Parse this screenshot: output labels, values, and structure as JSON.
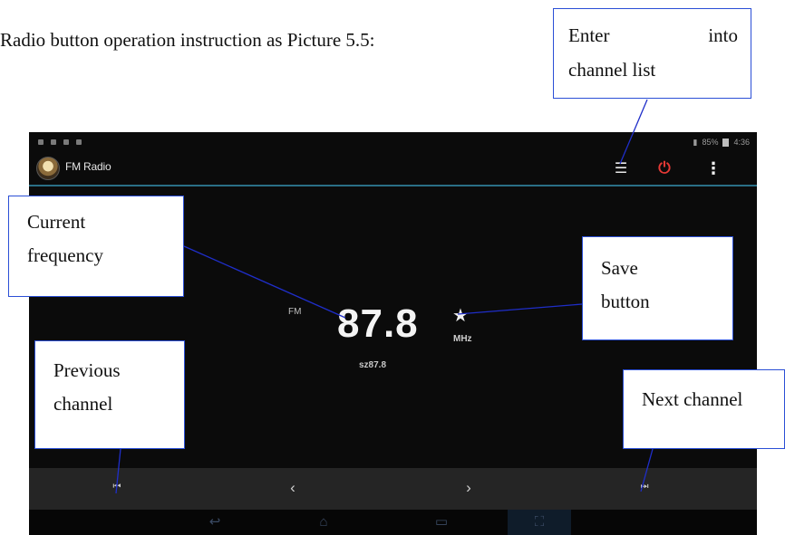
{
  "intro_text": "Radio button operation instruction as Picture 5.5:",
  "tablet": {
    "status": {
      "right_text": "85%",
      "time": "4:36"
    },
    "app_title": "FM Radio",
    "actions": {
      "list_icon": "list-icon",
      "power_icon": "power-icon",
      "menu_icon": "overflow-menu-icon"
    },
    "band": "FM",
    "frequency": "87.8",
    "unit": "MHz",
    "station": "sz87.8",
    "controls": {
      "prev_icon": "skip-previous-icon",
      "left_icon": "chevron-left-icon",
      "right_icon": "chevron-right-icon",
      "next_icon": "skip-next-icon"
    },
    "navbar": [
      "back-icon",
      "home-icon",
      "recent-apps-icon",
      "screenshot-icon"
    ]
  },
  "callouts": {
    "channel_list": {
      "word1": "Enter",
      "word2": "into",
      "word3": "channel list"
    },
    "current_frequency": {
      "line1": "Current",
      "line2": "frequency"
    },
    "save_button": {
      "line1": "Save",
      "line2": "button"
    },
    "previous_channel": {
      "line1": "Previous",
      "line2": "channel"
    },
    "next_channel": {
      "line1": "Next channel"
    }
  },
  "colors": {
    "callout_border": "#2b4fd6",
    "accent_divider": "#2a6f86",
    "power": "#e53935"
  }
}
